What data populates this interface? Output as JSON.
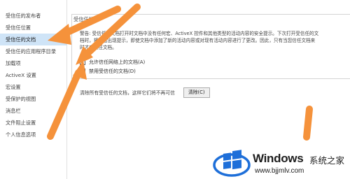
{
  "sidebar": {
    "items": [
      {
        "label": "受信任的发布者"
      },
      {
        "label": "受信任位置"
      },
      {
        "label": "受信任的文档",
        "selected": true
      },
      {
        "label": "受信任的应用程序目录"
      },
      {
        "label": "加载项"
      },
      {
        "label": "ActiveX 设置"
      },
      {
        "label": "宏设置"
      },
      {
        "label": "受保护的视图"
      },
      {
        "label": "消息栏"
      },
      {
        "label": "文件阻止设置"
      },
      {
        "label": "个人信息选项"
      }
    ]
  },
  "main": {
    "group_title": "受信任的文",
    "warning_lines": [
      "警告: 受信任的文档打开时文档中没有任何宏、ActiveX 控件和其他类型的活动内容的安全提示。下次打开受信任的文",
      "档时，将不会出现提示，即使文档中添加了新的活动内容或对现有活动内容进行了更改。因此，只有当您信任文档来",
      "时才应信任文档。"
    ],
    "options": [
      {
        "label": "允许信任网络上的文档(A)",
        "checked": true,
        "mark": "✓"
      },
      {
        "label": "禁用受信任的文档(D)",
        "checked": false,
        "mark": ""
      }
    ],
    "clear_text": "清除所有受信任的文档，这样它们将不再可信",
    "clear_button": "清除(C)"
  },
  "watermark": {
    "brand": "Windows",
    "chinese": "系统之家",
    "url": "www.bjjmlv.com"
  },
  "colors": {
    "selected_bg": "#cfe4f7",
    "arrow": "#f5923b",
    "logo_blue": "#1e6fd9"
  }
}
